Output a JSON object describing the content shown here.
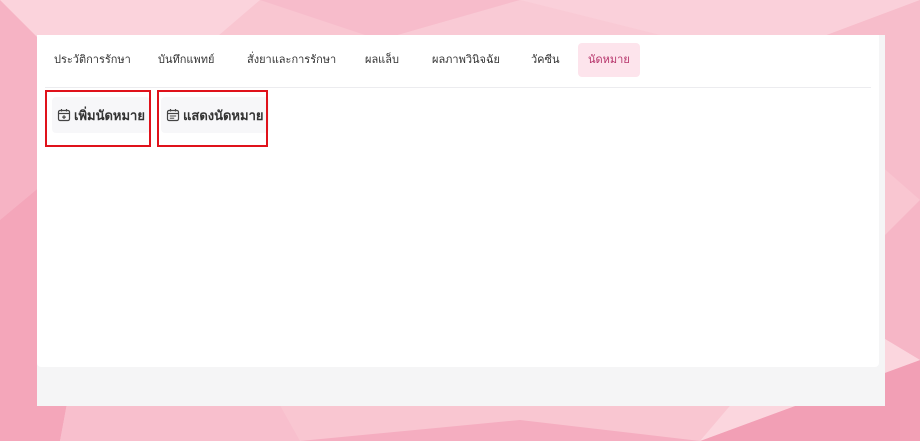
{
  "tabs": [
    {
      "label": "ประวัติการรักษา"
    },
    {
      "label": "บันทึกแพทย์"
    },
    {
      "label": "สั่งยาและการรักษา"
    },
    {
      "label": "ผลแล็บ"
    },
    {
      "label": "ผลภาพวินิจฉัย"
    },
    {
      "label": "วัคซีน"
    },
    {
      "label": "นัดหมาย",
      "active": true
    }
  ],
  "actions": {
    "add_appointment": {
      "label": "เพิ่มนัดหมาย",
      "icon": "calendar-plus-icon"
    },
    "show_appointments": {
      "label": "แสดงนัดหมาย",
      "icon": "calendar-list-icon"
    }
  },
  "colors": {
    "accent": "#b6336a",
    "active_tab_bg": "#fde4ec",
    "highlight_border": "#e0121b",
    "background_pink": "#f8c3cf"
  }
}
